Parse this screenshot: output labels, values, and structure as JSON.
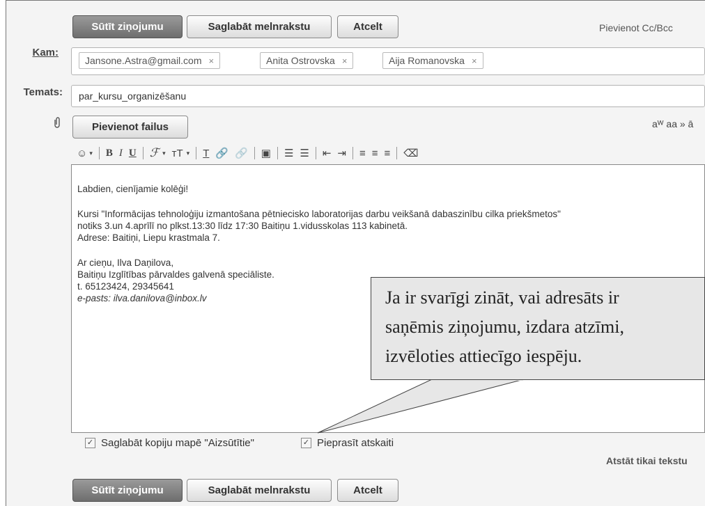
{
  "top_buttons": {
    "send": "Sūtīt ziņojumu",
    "save_draft": "Saglabāt melnrakstu",
    "cancel": "Atcelt"
  },
  "add_cc_bcc": "Pievienot Cc/Bcc",
  "to": {
    "label": "Kam:",
    "recipients": [
      "Jansone.Astra@gmail.com",
      "Anita Ostrovska",
      "Aija Romanovska"
    ],
    "remove_glyph": "×"
  },
  "subject": {
    "label": "Temats:",
    "value": "par_kursu_organizēšanu"
  },
  "attach": {
    "button": "Pievienot failus",
    "icon": "paperclip-icon"
  },
  "font_size_toggle": "aa » ā",
  "font_size_icon": "aᵂ",
  "toolbar": {
    "bold": "B",
    "italic": "I",
    "underline": "U",
    "font": "ℱ",
    "size": "тT",
    "color": "T",
    "emoji": "☺"
  },
  "body": {
    "greeting": "Labdien, cienījamie kolēģi!",
    "p1_line1": "Kursi \"Informācijas tehnoloģiju izmantošana pētniecisko laboratorijas darbu veikšanā dabaszinību cilka priekšmetos\"",
    "p1_line2": "notiks 3.un 4.aprīlī no plkst.13:30 līdz 17:30 Baitiņu 1.vidusskolas 113 kabinetā.",
    "p1_line3": "Adrese: Baitiņi, Liepu krastmala 7.",
    "sig1": "Ar cieņu, Ilva Daņilova,",
    "sig2": "Baitiņu Izglītības pārvaldes galvenā speciāliste.",
    "sig3": "t. 65123424, 29345641",
    "sig4": "e-pasts: ilva.danilova@inbox.lv"
  },
  "callout": {
    "line1": "Ja ir svarīgi zināt, vai adresāts ir",
    "line2": "saņēmis ziņojumu, izdara atzīmi,",
    "line3": "izvēloties attiecīgo iespēju."
  },
  "options": {
    "save_copy": "Saglabāt kopiju mapē \"Aizsūtītie\"",
    "request_receipt": "Pieprasīt atskaiti",
    "check_glyph": "✓"
  },
  "plain_text": "Atstāt tikai tekstu",
  "bottom_buttons": {
    "send": "Sūtīt ziņojumu",
    "save_draft": "Saglabāt melnrakstu",
    "cancel": "Atcelt"
  }
}
